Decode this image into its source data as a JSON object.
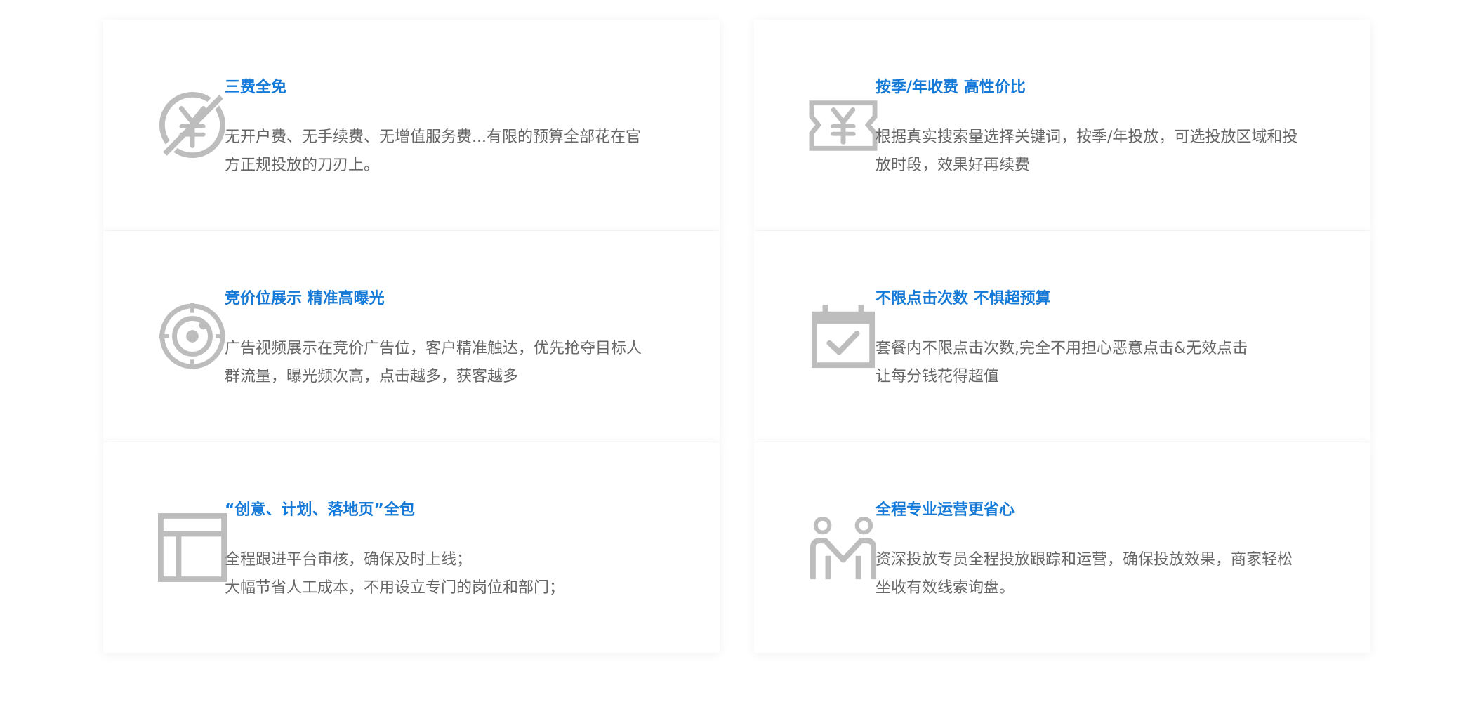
{
  "colors": {
    "title": "#1479d7",
    "text": "#666666",
    "icon": "#bdbdbd"
  },
  "features": [
    {
      "icon": "no-fee-yuan-icon",
      "title": "三费全免",
      "lines": [
        "无开户费、无手续费、无增值服务费...有限的预算全部花在官",
        "方正规投放的刀刃上。"
      ]
    },
    {
      "icon": "ticket-yuan-icon",
      "title": "按季/年收费 高性价比",
      "lines": [
        "根据真实搜索量选择关键词，按季/年投放，可选投放区域和投",
        "放时段，效果好再续费"
      ]
    },
    {
      "icon": "radar-target-icon",
      "title": "竞价位展示 精准高曝光",
      "lines": [
        "广告视频展示在竞价广告位，客户精准触达，优先抢夺目标人",
        "群流量，曝光频次高，点击越多，获客越多"
      ]
    },
    {
      "icon": "calendar-check-icon",
      "title": "不限点击次数 不惧超预算",
      "lines": [
        "套餐内不限点击次数,完全不用担心恶意点击&无效点击",
        "让每分钱花得超值"
      ]
    },
    {
      "icon": "layout-page-icon",
      "title": "“创意、计划、落地页”全包",
      "lines": [
        "全程跟进平台审核，确保及时上线；",
        "大幅节省人工成本，不用设立专门的岗位和部门；"
      ]
    },
    {
      "icon": "service-team-icon",
      "title": "全程专业运营更省心",
      "lines": [
        "资深投放专员全程投放跟踪和运营，确保投放效果，商家轻松",
        "坐收有效线索询盘。"
      ]
    }
  ]
}
